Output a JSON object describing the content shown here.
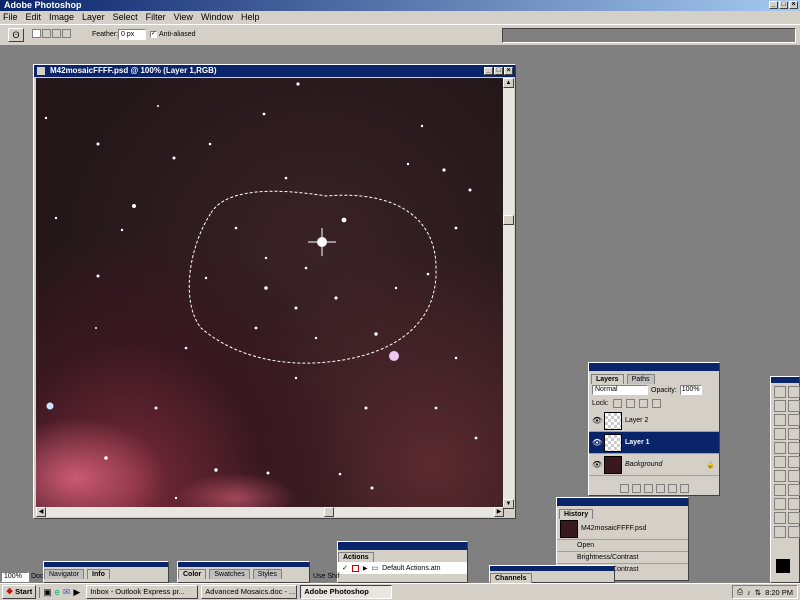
{
  "app": {
    "title": "Adobe Photoshop"
  },
  "menu": [
    "File",
    "Edit",
    "Image",
    "Layer",
    "Select",
    "Filter",
    "View",
    "Window",
    "Help"
  ],
  "options": {
    "feather_label": "Feather:",
    "feather_value": "0 px",
    "antialias_label": "Anti-aliased"
  },
  "document": {
    "title": "M42mosaicFFFF.psd @ 100% (Layer 1,RGB)"
  },
  "status": {
    "zoom": "100%",
    "doc_label": "Doc",
    "hint": "Use Shif"
  },
  "panels": {
    "navigator": {
      "tabs": [
        "Navigator",
        "Info"
      ]
    },
    "color": {
      "tabs": [
        "Color",
        "Swatches",
        "Styles"
      ]
    },
    "actions": {
      "tab": "Actions",
      "item": "Default Actions.atn"
    },
    "channels": {
      "tab": "Channels"
    },
    "history": {
      "tab": "History",
      "snapshot": "M42mosaicFFFF.psd",
      "items": [
        "Open",
        "Brightness/Contrast",
        "Brightness/Contrast"
      ]
    },
    "layers": {
      "tabs": [
        "Layers",
        "Paths"
      ],
      "blend_mode": "Normal",
      "opacity_label": "Opacity:",
      "opacity_value": "100%",
      "lock_label": "Lock:",
      "rows": [
        {
          "name": "Layer 2"
        },
        {
          "name": "Layer 1"
        },
        {
          "name": "Background"
        }
      ]
    }
  },
  "taskbar": {
    "start": "Start",
    "tasks": [
      "Inbox - Outlook Express pr...",
      "Advanced Mosaics.doc - ...",
      "Adobe Photoshop"
    ],
    "clock": "8:20 PM"
  },
  "colors": {
    "titlebar": "#0a246a",
    "chrome": "#d4d0c8",
    "workspace": "#808080"
  }
}
